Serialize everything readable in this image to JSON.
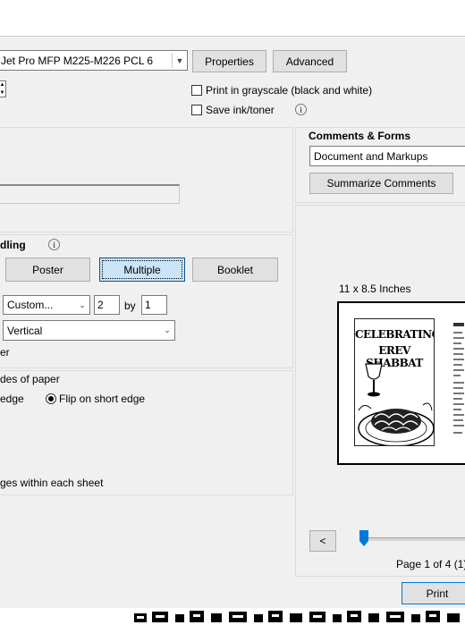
{
  "printer": {
    "name_selected": "Jet Pro MFP M225-M226 PCL 6",
    "properties_label": "Properties",
    "advanced_label": "Advanced",
    "grayscale_label": "Print in grayscale (black and white)",
    "grayscale_checked": false,
    "save_ink_label": "Save ink/toner",
    "save_ink_checked": false
  },
  "comments_forms": {
    "heading": "Comments & Forms",
    "selected": "Document and Markups",
    "summarize_label": "Summarize Comments"
  },
  "page_handling": {
    "heading_partial": "dling",
    "tabs": [
      {
        "label": "Poster",
        "selected": false
      },
      {
        "label": "Multiple",
        "selected": true
      },
      {
        "label": "Booklet",
        "selected": false
      }
    ],
    "pages_per_sheet": "Custom...",
    "cols": "2",
    "by_label": "by",
    "rows": "1",
    "orientation": "Vertical",
    "order_partial": "er"
  },
  "duplex": {
    "heading_partial": "des of paper",
    "long_edge_partial": "edge",
    "short_edge_label": "Flip on short edge",
    "short_edge_selected": true,
    "pages_within_partial": "ges within each sheet"
  },
  "preview": {
    "size_label": "11 x 8.5 Inches",
    "flyer_title_line1": "CELEBRATING",
    "flyer_title_line2": "EREV SHABBAT",
    "prev_label": "<",
    "page_info": "Page 1 of 4 (1)",
    "slider_position": 0
  },
  "footer": {
    "print_label": "Print"
  }
}
